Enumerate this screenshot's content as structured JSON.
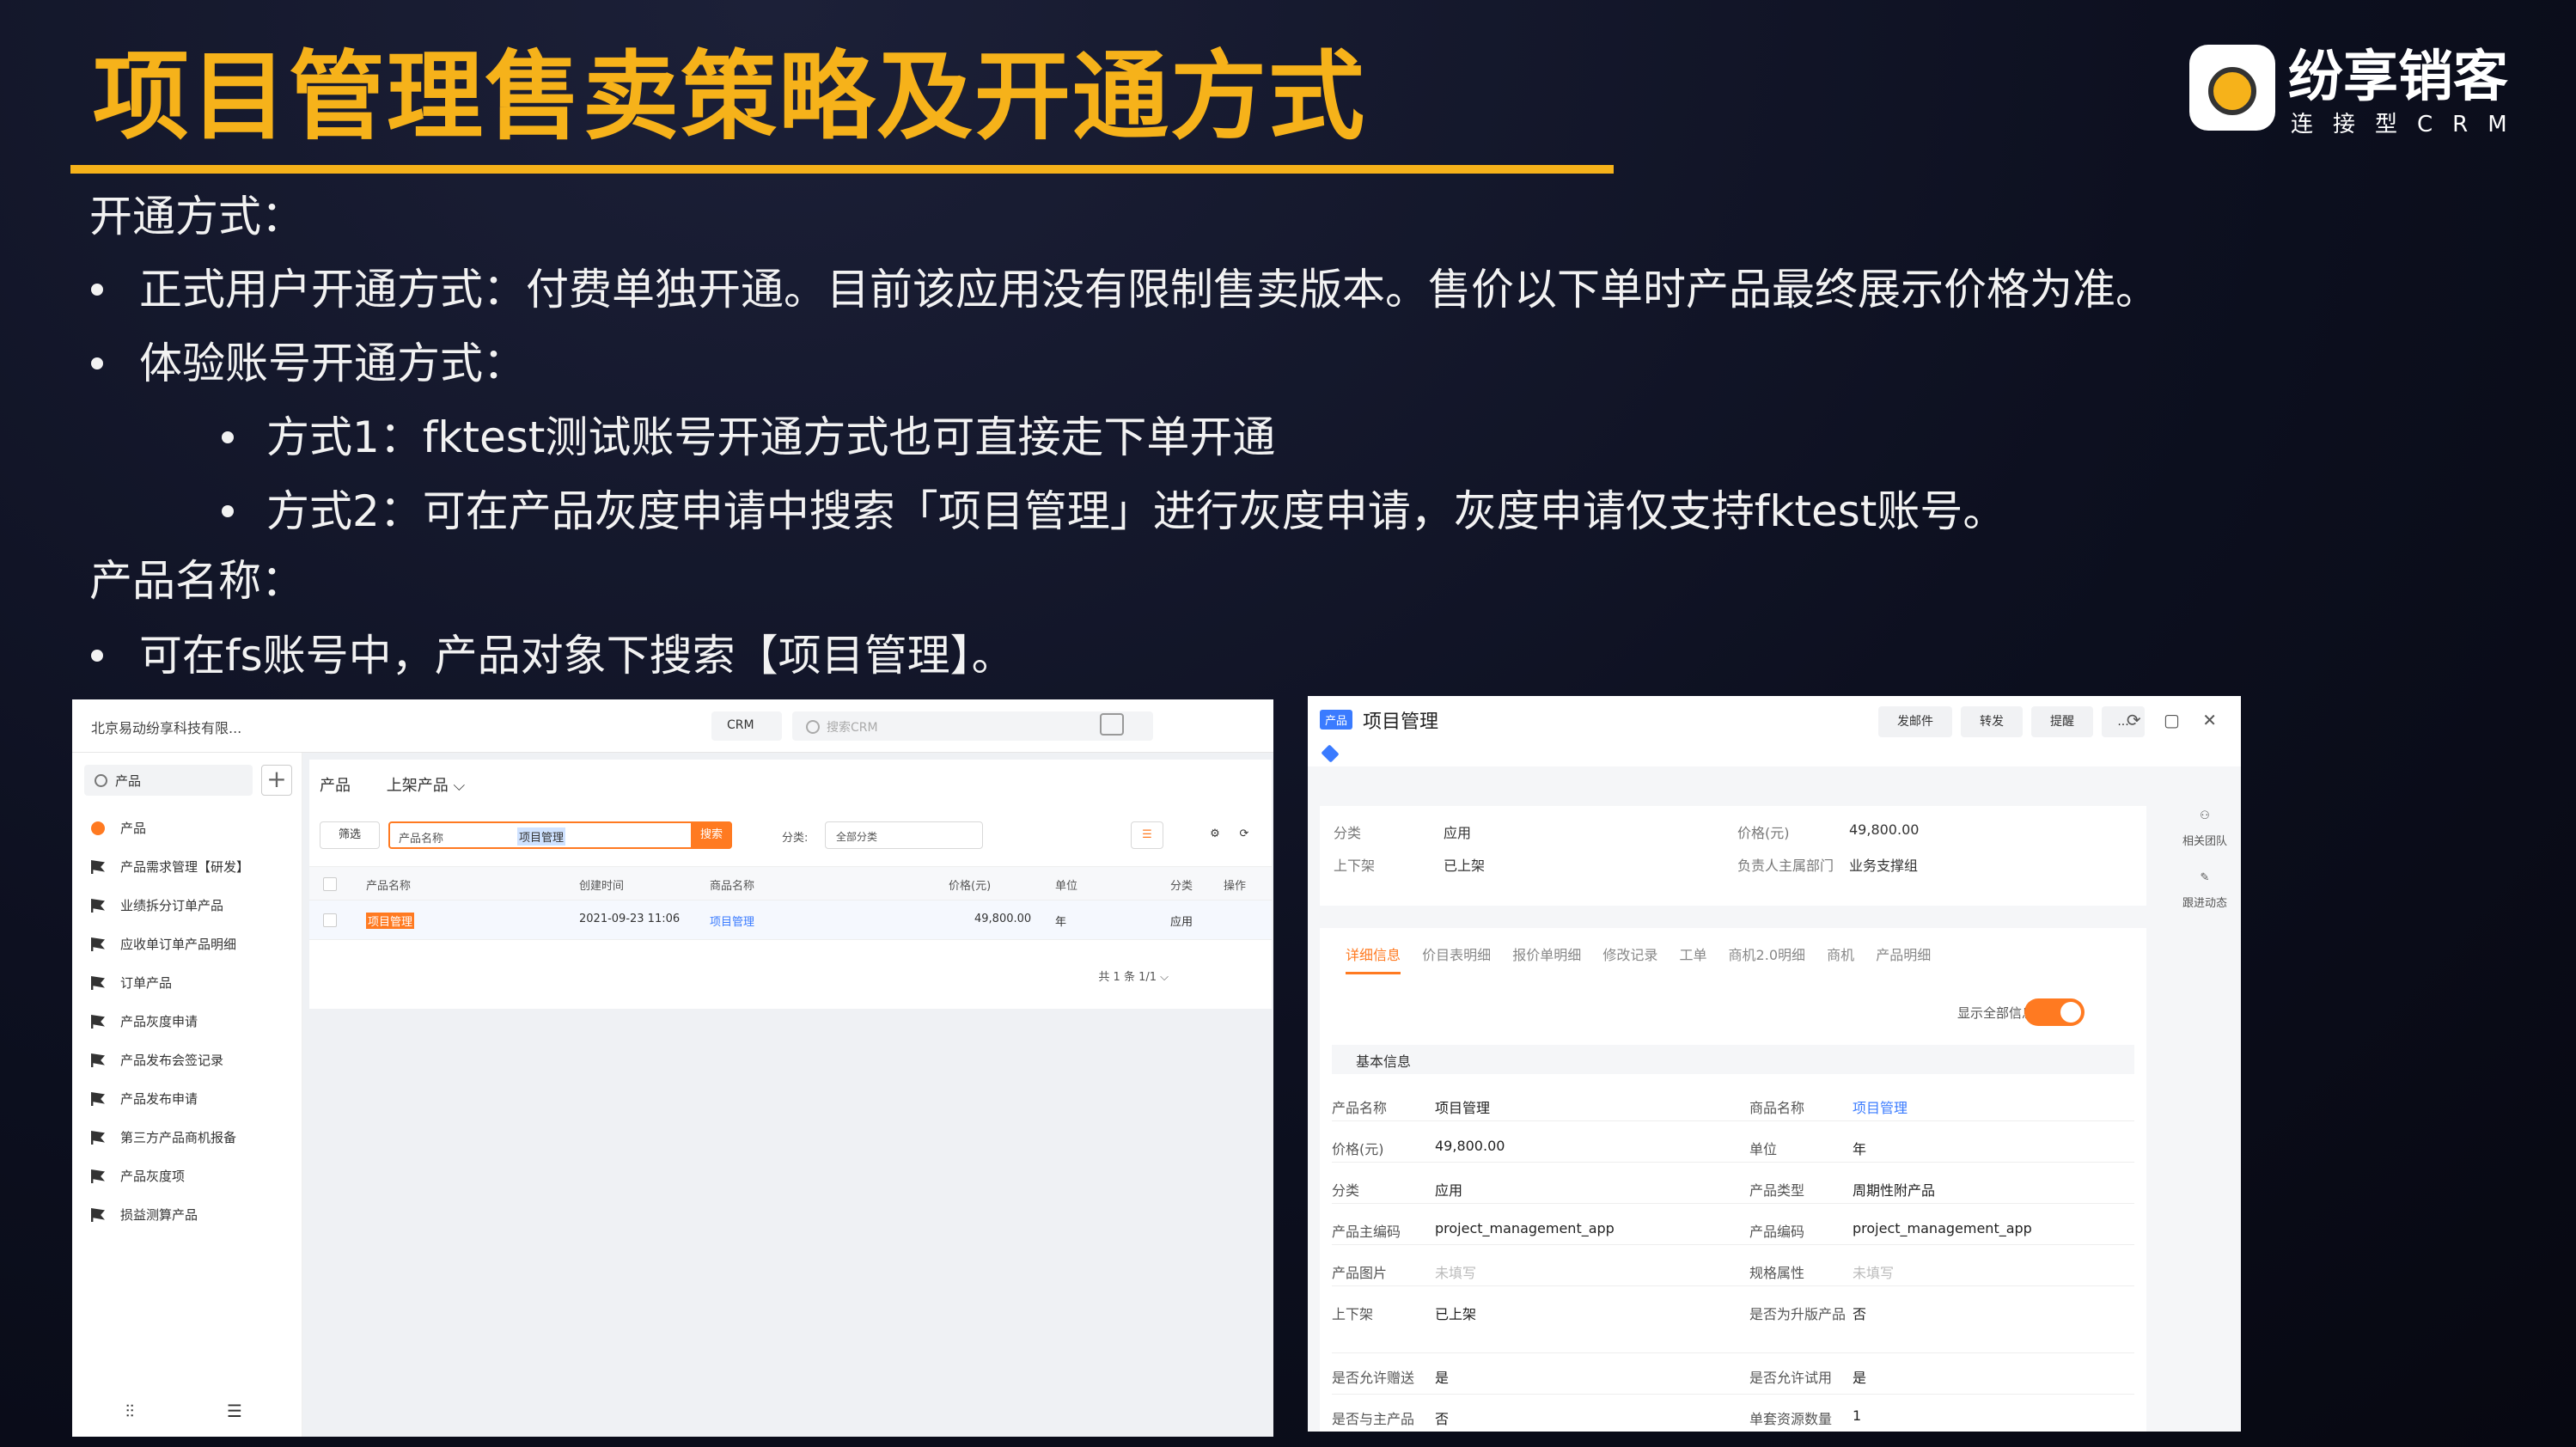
{
  "slide": {
    "title": "项目管理售卖策略及开通方式",
    "logo_name": "纷享销客",
    "logo_sub": "连接型CRM",
    "lines": [
      "开通方式：",
      "正式用户开通方式：付费单独开通。目前该应用没有限制售卖版本。售价以下单时产品最终展示价格为准。",
      "体验账号开通方式：",
      "方式1：fktest测试账号开通方式也可直接走下单开通",
      "方式2：可在产品灰度申请中搜索「项目管理」进行灰度申请，灰度申请仅支持fktest账号。",
      "产品名称：",
      "可在fs账号中，产品对象下搜索【项目管理】。"
    ]
  },
  "left_shot": {
    "company": "北京易动纷享科技有限...",
    "crm_selector": "CRM",
    "search_placeholder": "搜索CRM",
    "side_search_value": "产品",
    "side_add": "+",
    "nav_items": [
      "产品",
      "产品需求管理【研发】",
      "业绩拆分订单产品",
      "应收单订单产品明细",
      "订单产品",
      "产品灰度申请",
      "产品发布会签记录",
      "产品发布申请",
      "第三方产品商机报备",
      "产品灰度项",
      "损益测算产品"
    ],
    "tabs": [
      "产品",
      "上架产品 ⌵"
    ],
    "filter_btn": "筛选",
    "search_field": "产品名称",
    "search_value": "项目管理",
    "search_go": "搜索",
    "category_label": "分类:",
    "category_value": "全部分类",
    "columns": [
      "产品名称",
      "创建时间",
      "商品名称",
      "价格(元)",
      "单位",
      "分类",
      "操作"
    ],
    "row": {
      "name": "项目管理",
      "created": "2021-09-23 11:06",
      "goods": "项目管理",
      "price": "49,800.00",
      "unit": "年",
      "category": "应用"
    },
    "pager": "共 1 条    1/1 ⌵"
  },
  "right_shot": {
    "badge": "产品",
    "title": "项目管理",
    "header_buttons": [
      "发邮件",
      "转发",
      "提醒",
      "..."
    ],
    "window_icons": "⟳ ▢ ✕",
    "summary": [
      {
        "k": "分类",
        "v": "应用"
      },
      {
        "k": "价格(元)",
        "v": "49,800.00"
      },
      {
        "k": "上下架",
        "v": "已上架"
      },
      {
        "k": "负责人主属部门",
        "v": "业务支撑组"
      }
    ],
    "rail": [
      "相关团队",
      "跟进动态"
    ],
    "tabs": [
      "详细信息",
      "价目表明细",
      "报价单明细",
      "修改记录",
      "工单",
      "商机2.0明细",
      "商机",
      "产品明细"
    ],
    "show_all": "显示全部信息",
    "section": "基本信息",
    "fields_left": [
      {
        "k": "产品名称",
        "v": "项目管理"
      },
      {
        "k": "价格(元)",
        "v": "49,800.00"
      },
      {
        "k": "分类",
        "v": "应用"
      },
      {
        "k": "产品主编码",
        "v": "project_management_app"
      },
      {
        "k": "产品图片",
        "v": "未填写"
      },
      {
        "k": "上下架",
        "v": "已上架"
      },
      {
        "k": "是否允许赠送",
        "v": "是"
      },
      {
        "k": "是否与主产品",
        "v": "否"
      }
    ],
    "fields_right": [
      {
        "k": "商品名称",
        "v": "项目管理"
      },
      {
        "k": "单位",
        "v": "年"
      },
      {
        "k": "产品类型",
        "v": "周期性附产品"
      },
      {
        "k": "产品编码",
        "v": "project_management_app"
      },
      {
        "k": "规格属性",
        "v": "未填写"
      },
      {
        "k": "是否为升版产品",
        "v": "否"
      },
      {
        "k": "是否允许试用",
        "v": "是"
      },
      {
        "k": "单套资源数量",
        "v": "1"
      }
    ]
  }
}
